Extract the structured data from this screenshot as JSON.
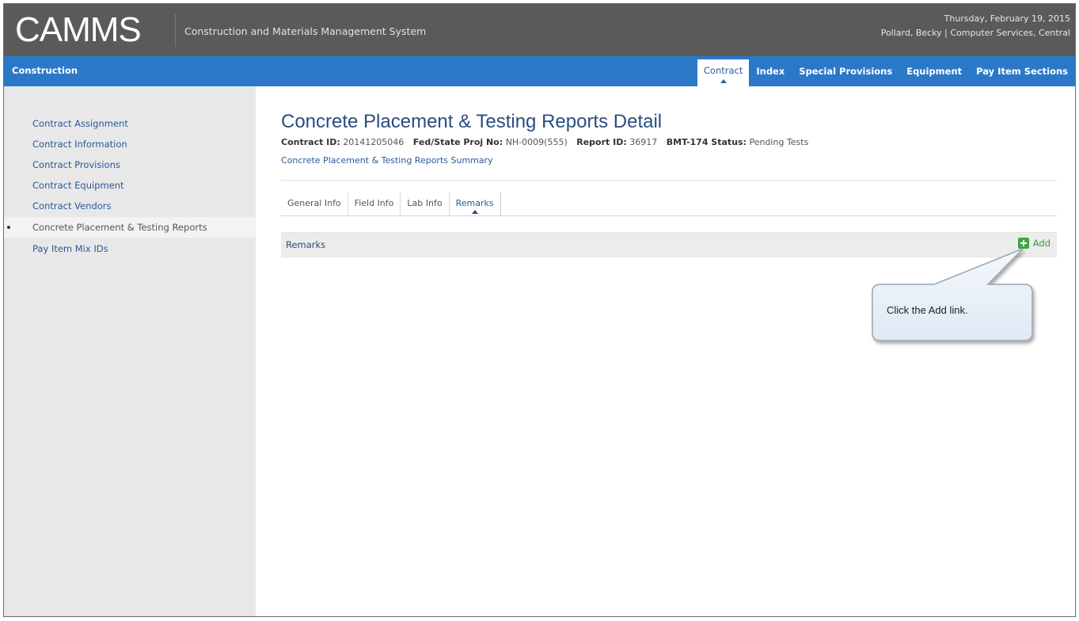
{
  "header": {
    "logo": "CAMMS",
    "app_name": "Construction and Materials Management System",
    "date": "Thursday, February 19, 2015",
    "user": "Pollard, Becky | Computer Services, Central"
  },
  "nav": {
    "module": "Construction",
    "tabs": [
      "Contract",
      "Index",
      "Special Provisions",
      "Equipment",
      "Pay Item Sections"
    ],
    "active_tab": "Contract"
  },
  "sidebar": {
    "items": [
      {
        "label": "Contract Assignment"
      },
      {
        "label": "Contract Information"
      },
      {
        "label": "Contract Provisions"
      },
      {
        "label": "Contract Equipment"
      },
      {
        "label": "Contract Vendors"
      },
      {
        "label": "Concrete Placement & Testing Reports",
        "active": true
      },
      {
        "label": "Pay Item Mix IDs"
      }
    ]
  },
  "main": {
    "title": "Concrete Placement & Testing Reports Detail",
    "meta": {
      "contract_id_label": "Contract ID:",
      "contract_id": "20141205046",
      "proj_label": "Fed/State Proj No:",
      "proj_no": "NH-0009(555)",
      "report_label": "Report ID:",
      "report_id": "36917",
      "status_label": "BMT-174 Status:",
      "status": "Pending Tests"
    },
    "breadcrumb": "Concrete Placement & Testing Reports Summary",
    "subtabs": [
      "General Info",
      "Field Info",
      "Lab Info",
      "Remarks"
    ],
    "active_subtab": "Remarks",
    "section": {
      "label": "Remarks",
      "add_label": "Add"
    }
  },
  "callout": {
    "text": "Click the Add link."
  },
  "colors": {
    "topbar": "#5a5a5a",
    "navbar": "#2c78c8",
    "link": "#2a5a98",
    "add_green": "#3fa447"
  }
}
